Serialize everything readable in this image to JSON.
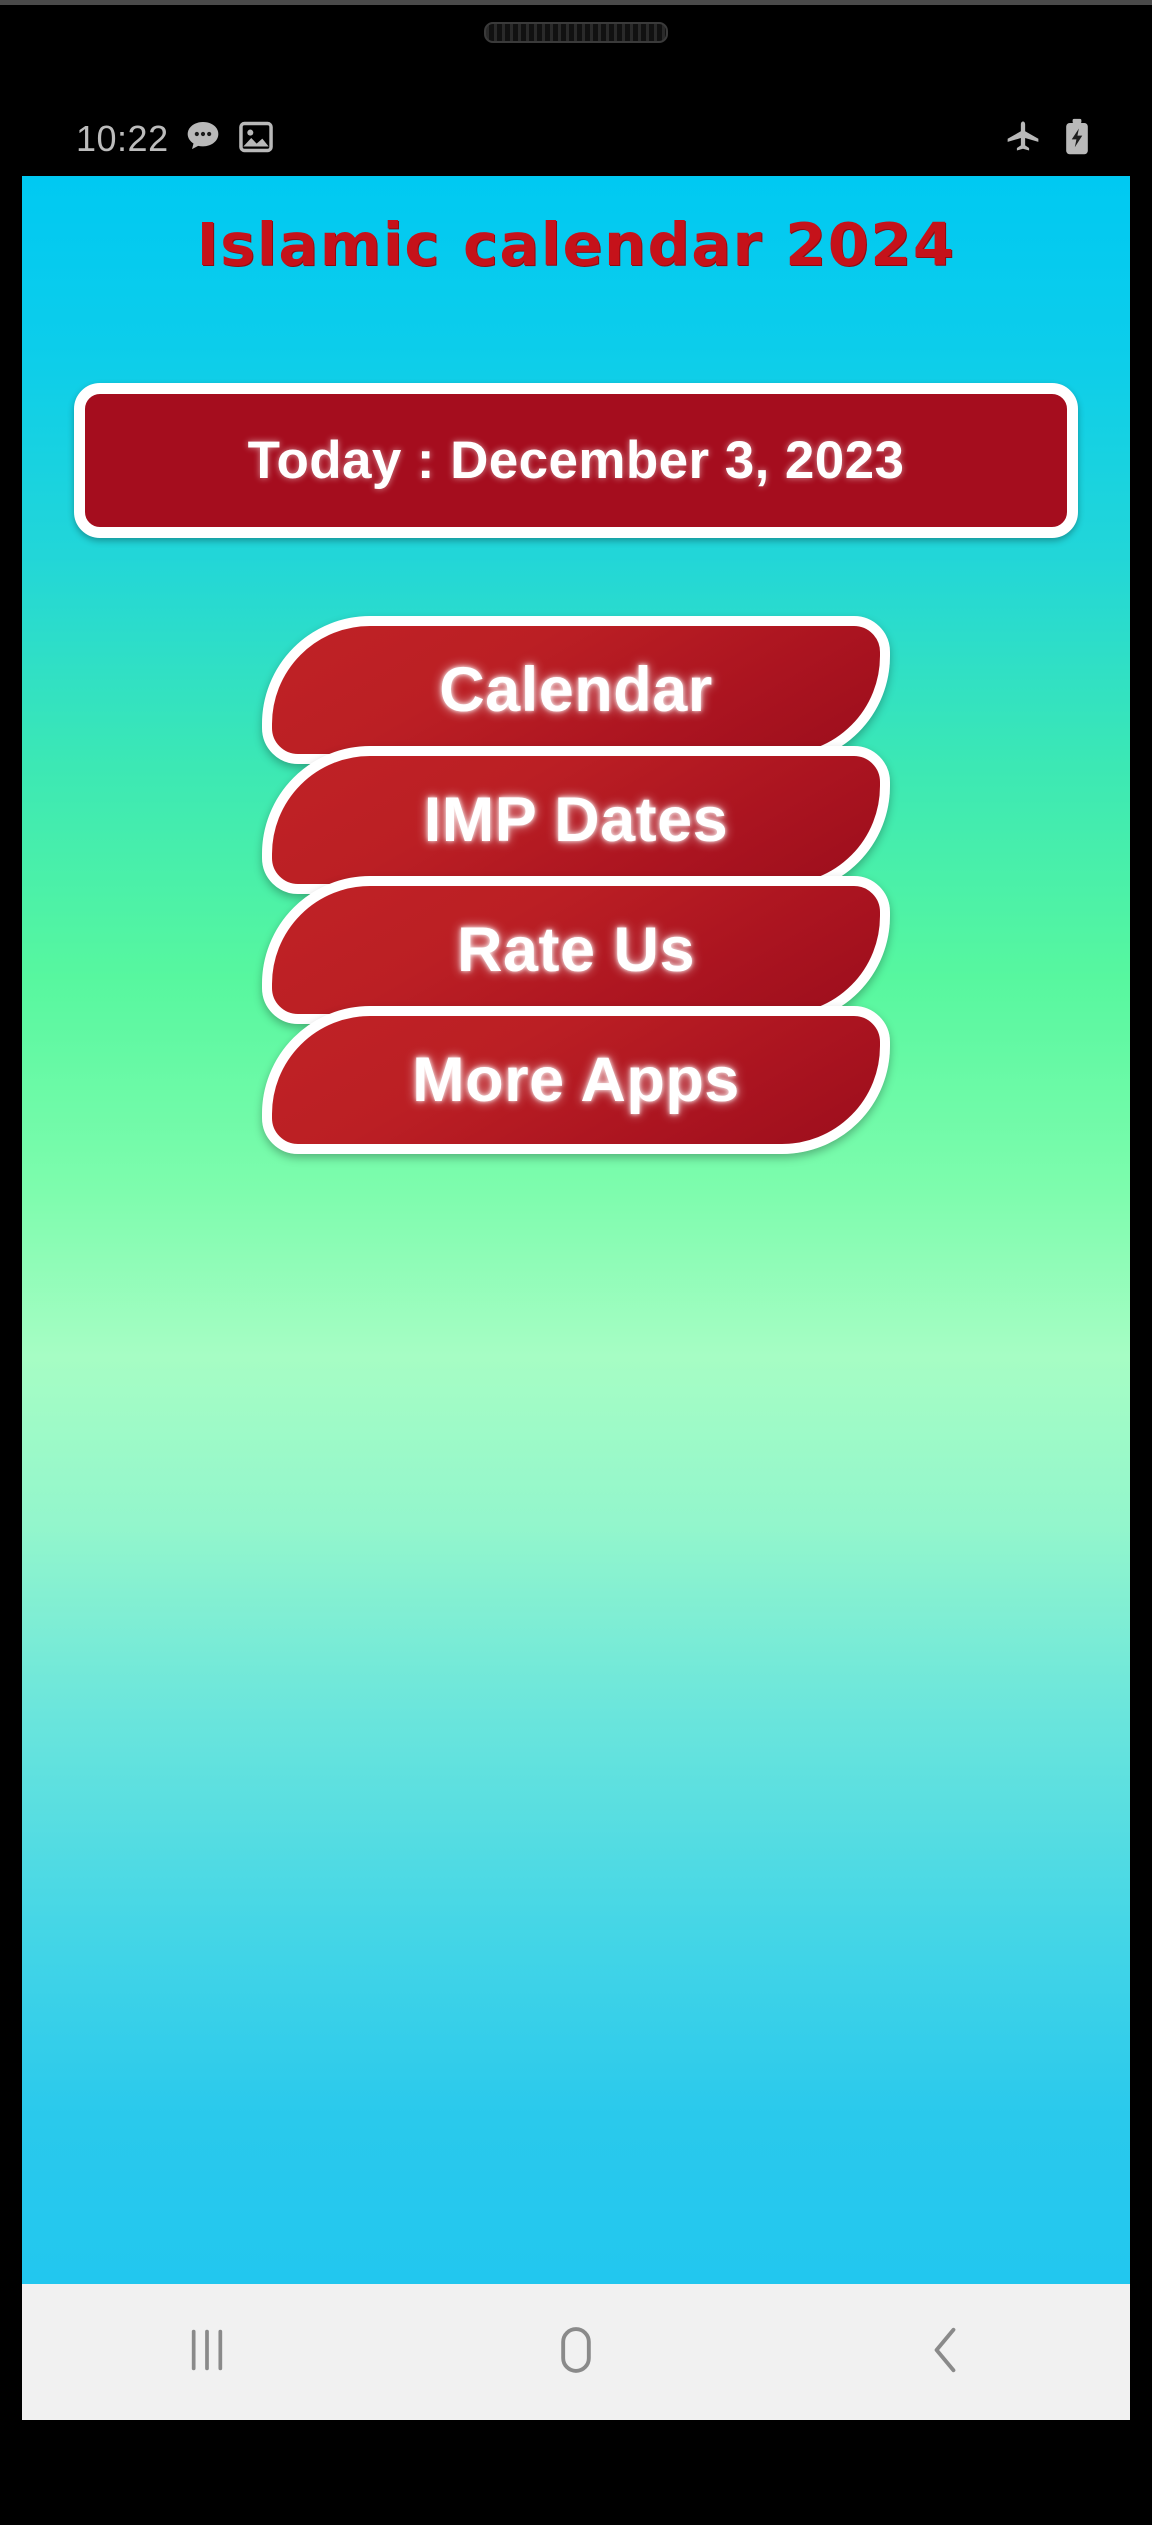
{
  "device": {
    "frame_color": "#000000",
    "earpiece_name": "earpiece-speaker"
  },
  "status_bar": {
    "clock": "10:22",
    "left_icons": [
      {
        "name": "messages-icon",
        "label": "messages"
      },
      {
        "name": "gallery-icon",
        "label": "gallery"
      }
    ],
    "right_icons": [
      {
        "name": "airplane-mode-icon",
        "label": "airplane mode"
      },
      {
        "name": "battery-charging-icon",
        "label": "battery charging"
      }
    ],
    "text_color": "#b9b9b9",
    "background_color": "#000000"
  },
  "app": {
    "title": "Islamic calendar 2024",
    "title_color": "#c5121a",
    "background_gradient": [
      "#00c9f2",
      "#57f79f",
      "#a6fdc4",
      "#22c7ef"
    ],
    "today_banner": {
      "label": "Today : December 3, 2023",
      "background_color": "#a50d1e",
      "border_color": "#ffffff",
      "text_color": "#ffffff"
    },
    "buttons": [
      {
        "label": "Calendar",
        "name": "calendar-button"
      },
      {
        "label": "IMP Dates",
        "name": "imp-dates-button"
      },
      {
        "label": "Rate Us",
        "name": "rate-us-button"
      },
      {
        "label": "More Apps",
        "name": "more-apps-button"
      }
    ],
    "button_color": "#bb1f24",
    "button_border_color": "#ffffff",
    "button_text_color": "#ffffff"
  },
  "nav_bar": {
    "background_color": "#f1f1f1",
    "icon_color": "#8a8a8a",
    "items": [
      {
        "name": "recents-icon",
        "label": "Recents"
      },
      {
        "name": "home-icon",
        "label": "Home"
      },
      {
        "name": "back-icon",
        "label": "Back"
      }
    ]
  }
}
